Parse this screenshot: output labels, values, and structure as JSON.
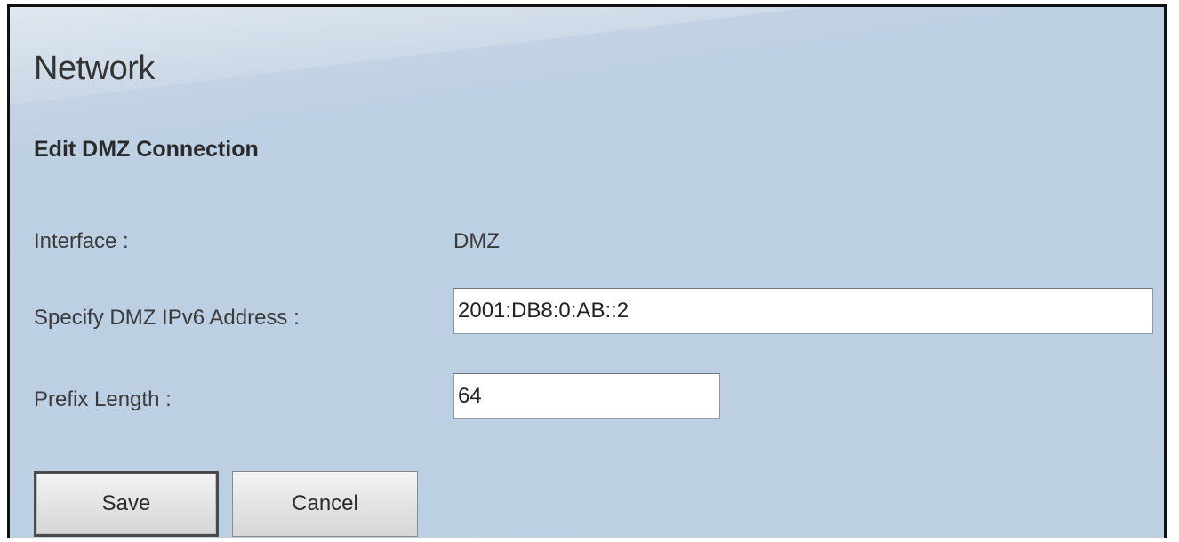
{
  "page": {
    "title": "Network",
    "section_title": "Edit DMZ Connection"
  },
  "form": {
    "interface": {
      "label": "Interface :",
      "value": "DMZ"
    },
    "ipv6_address": {
      "label": "Specify DMZ IPv6 Address :",
      "value": "2001:DB8:0:AB::2"
    },
    "prefix_length": {
      "label": "Prefix Length :",
      "value": "64"
    }
  },
  "buttons": {
    "save_label": "Save",
    "cancel_label": "Cancel"
  },
  "colors": {
    "background": "#bccfe3",
    "border": "#111111",
    "text": "#333333"
  }
}
